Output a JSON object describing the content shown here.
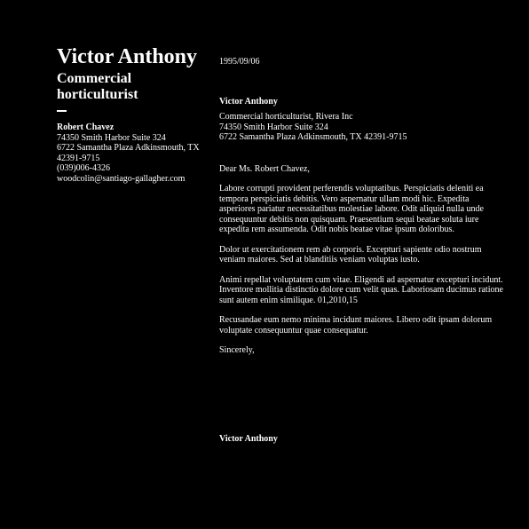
{
  "sender": {
    "name": "Victor Anthony",
    "title": "Commercial horticulturist"
  },
  "contact": {
    "name": "Robert Chavez",
    "street": "74350 Smith Harbor Suite 324",
    "city": "6722 Samantha Plaza Adkinsmouth, TX 42391-9715",
    "phone": "(039)006-4326",
    "email": "woodcolin@santiago-gallagher.com"
  },
  "letter": {
    "date": "1995/09/06",
    "recipient_name": "Victor Anthony",
    "address_lines": [
      "Commercial horticulturist, Rivera Inc",
      "74350 Smith Harbor Suite 324",
      "6722 Samantha Plaza Adkinsmouth, TX 42391-9715"
    ],
    "salutation": "Dear Ms. Robert Chavez,",
    "paragraphs": [
      "Labore corrupti provident perferendis voluptatibus. Perspiciatis deleniti ea tempora perspiciatis debitis. Vero aspernatur ullam modi hic. Expedita asperiores pariatur necessitatibus molestiae labore. Odit aliquid nulla unde consequuntur debitis non quisquam. Praesentium sequi beatae soluta iure expedita rem assumenda. Odit nobis beatae vitae ipsum doloribus.",
      "Dolor ut exercitationem rem ab corporis. Excepturi sapiente odio nostrum veniam maiores. Sed at blanditiis veniam voluptas iusto.",
      "Animi repellat voluptatem cum vitae. Eligendi ad aspernatur excepturi incidunt. Inventore mollitia distinctio dolore cum velit quas. Laboriosam ducimus ratione sunt autem enim similique. 01,2010,15",
      "Recusandae eum nemo minima incidunt maiores. Libero odit ipsam dolorum voluptate consequuntur quae consequatur."
    ],
    "closing": "Sincerely,",
    "signature": "Victor Anthony"
  }
}
